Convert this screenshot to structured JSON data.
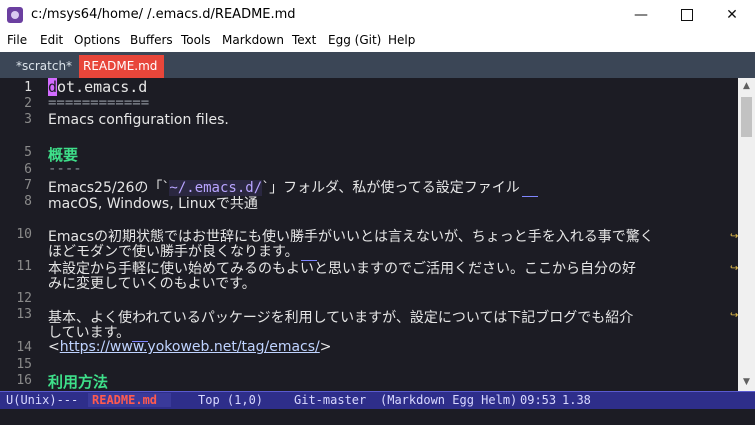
{
  "window": {
    "title": "c:/msys64/home/    /.emacs.d/README.md",
    "minimize": "—",
    "close": "✕"
  },
  "menu": [
    "File",
    "Edit",
    "Options",
    "Buffers",
    "Tools",
    "Markdown",
    "Text",
    "Egg (Git)",
    "Help"
  ],
  "tabs": [
    {
      "label": "*scratch*",
      "active": false
    },
    {
      "label": "README.md",
      "active": true
    }
  ],
  "gutter": {
    "line_numbers": [
      "1",
      "2",
      "3",
      "",
      "5",
      "6",
      "7",
      "8",
      "",
      "10",
      "",
      "11",
      "",
      "12",
      "13",
      "",
      "14",
      "15",
      "16"
    ]
  },
  "content": {
    "l1_cursor": "d",
    "l1_rest": "ot.emacs.d",
    "l2": "============",
    "l3": "Emacs configuration files.",
    "l5": "概要",
    "l6": "----",
    "l7_a": "Emacs25/26の「`",
    "l7_code": "~/.emacs.d/",
    "l7_b": "`」フォルダ、私が使ってる設定ファイル",
    "l8": "macOS, Windows, Linuxで共通",
    "l10a": "Emacsの初期状態ではお世辞にも使い勝手がいいとは言えないが、ちょっと手を入れる事で驚く",
    "l10b": "ほどモダンで使い勝手が良くなります。",
    "l11a": "本設定から手軽に使い始めてみるのもよいと思いますのでご活用ください。ここから自分の好",
    "l11b": "みに変更していくのもよいです。",
    "l13a": "基本、よく使われているパッケージを利用していますが、設定については下記ブログでも紹介",
    "l13b": "しています。",
    "l14_open": "<",
    "l14_url": "https://www.yokoweb.net/tag/emacs/",
    "l14_close": ">",
    "l16": "利用方法"
  },
  "modeline": {
    "encoding": "U(Unix)---",
    "buffer": "README.md",
    "position": "Top (1,0)",
    "git": "Git-master",
    "modes": "(Markdown Egg Helm)",
    "time": "09:53",
    "load": "1.38"
  },
  "colors": {
    "tab_active": "#e8463a",
    "heading": "#3ee08a",
    "cursor": "#d26bff",
    "modeline_bg": "#2e2e8a"
  }
}
